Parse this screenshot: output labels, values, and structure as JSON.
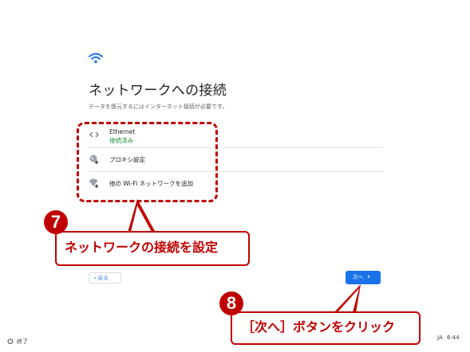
{
  "page": {
    "title": "ネットワークへの接続",
    "subtitle": "データを復元するにはインターネット接続が必要です。"
  },
  "network_list": [
    {
      "icon": "ethernet-icon",
      "label": "Ethernet",
      "status": "接続済み"
    },
    {
      "icon": "proxy-globe-icon",
      "label": "プロキシ設定"
    },
    {
      "icon": "add-wifi-icon",
      "label": "他の Wi-Fi ネットワークを追加"
    }
  ],
  "buttons": {
    "back_label": "戻る",
    "next_label": "次へ"
  },
  "footer": {
    "shutdown_label": "終了",
    "language": "JA",
    "time": "6:44"
  },
  "annotations": {
    "badge7": "7",
    "callout7": "ネットワークの接続を設定",
    "badge8": "8",
    "callout8": "［次へ］ボタンをクリック"
  },
  "colors": {
    "accent": "#1a73e8",
    "connected": "#1e8e3e",
    "annotation": "#c00000"
  }
}
